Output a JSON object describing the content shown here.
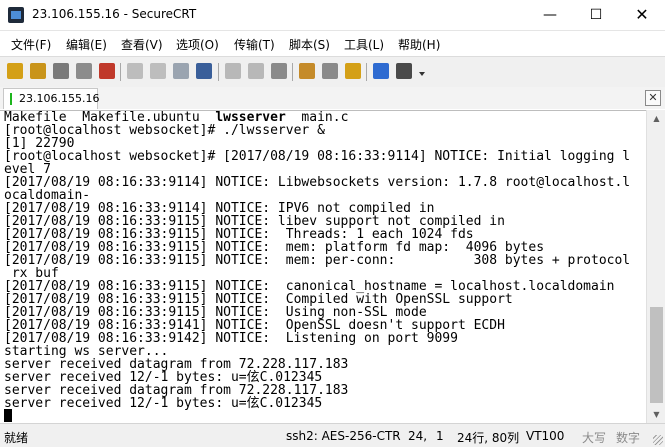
{
  "window": {
    "title": "23.106.155.16 - SecureCRT"
  },
  "menu": [
    "文件(F)",
    "编辑(E)",
    "查看(V)",
    "选项(O)",
    "传输(T)",
    "脚本(S)",
    "工具(L)",
    "帮助(H)"
  ],
  "toolbar": {
    "buttons": [
      {
        "icon": "connect-icon",
        "color": "#d4a017"
      },
      {
        "icon": "quick-connect-icon",
        "color": "#c9941a"
      },
      {
        "icon": "connect-in-tab-icon",
        "color": "#7a7a7a"
      },
      {
        "icon": "reconnect-icon",
        "color": "#8c8c8c"
      },
      {
        "icon": "disconnect-icon",
        "color": "#c0392b"
      },
      {
        "icon": "copy-icon",
        "color": "#bdbdbd"
      },
      {
        "icon": "paste-icon",
        "color": "#bdbdbd"
      },
      {
        "icon": "copy-paste-icon",
        "color": "#9aa4b0"
      },
      {
        "icon": "find-icon",
        "color": "#3a5f9a"
      },
      {
        "icon": "print-screen-icon",
        "color": "#b8b8b8"
      },
      {
        "icon": "print-selection-icon",
        "color": "#b8b8b8"
      },
      {
        "icon": "print-icon",
        "color": "#8a8a8a"
      },
      {
        "icon": "session-options-icon",
        "color": "#c58b2a"
      },
      {
        "icon": "global-options-icon",
        "color": "#8a8a8a"
      },
      {
        "icon": "keymap-icon",
        "color": "#d4a017"
      },
      {
        "icon": "help-icon",
        "color": "#2e6bd1"
      },
      {
        "icon": "sftp-icon",
        "color": "#4a4a4a"
      }
    ]
  },
  "tab": {
    "label": "23.106.155.16",
    "status_color": "#1db51d"
  },
  "terminal": {
    "lines": [
      "Makefile  Makefile.ubuntu  lwsserver  main.c",
      "[root@localhost websocket]# ./lwsserver &",
      "[1] 22790",
      "[root@localhost websocket]# [2017/08/19 08:16:33:9114] NOTICE: Initial logging l",
      "evel 7",
      "[2017/08/19 08:16:33:9114] NOTICE: Libwebsockets version: 1.7.8 root@localhost.l",
      "ocaldomain-",
      "[2017/08/19 08:16:33:9114] NOTICE: IPV6 not compiled in",
      "[2017/08/19 08:16:33:9115] NOTICE: libev support not compiled in",
      "[2017/08/19 08:16:33:9115] NOTICE:  Threads: 1 each 1024 fds",
      "[2017/08/19 08:16:33:9115] NOTICE:  mem: platform fd map:  4096 bytes",
      "[2017/08/19 08:16:33:9115] NOTICE:  mem: per-conn:          308 bytes + protocol",
      " rx buf",
      "[2017/08/19 08:16:33:9115] NOTICE:  canonical_hostname = localhost.localdomain",
      "[2017/08/19 08:16:33:9115] NOTICE:  Compiled with OpenSSL support",
      "[2017/08/19 08:16:33:9115] NOTICE:  Using non-SSL mode",
      "[2017/08/19 08:16:33:9141] NOTICE:  OpenSSL doesn't support ECDH",
      "[2017/08/19 08:16:33:9142] NOTICE:  Listening on port 9099",
      "starting ws server...",
      "server received datagram from 72.228.117.183",
      "server received 12/-1 bytes: u=伭C.012345",
      "server received datagram from 72.228.117.183",
      "server received 12/-1 bytes: u=伭C.012345"
    ]
  },
  "status": {
    "ready": "就绪",
    "cipher": "ssh2: AES-256-CTR",
    "row": "24,",
    "col": "1",
    "size": "24行, 80列",
    "terminal_type": "VT100",
    "caps": "大写",
    "num": "数字"
  }
}
